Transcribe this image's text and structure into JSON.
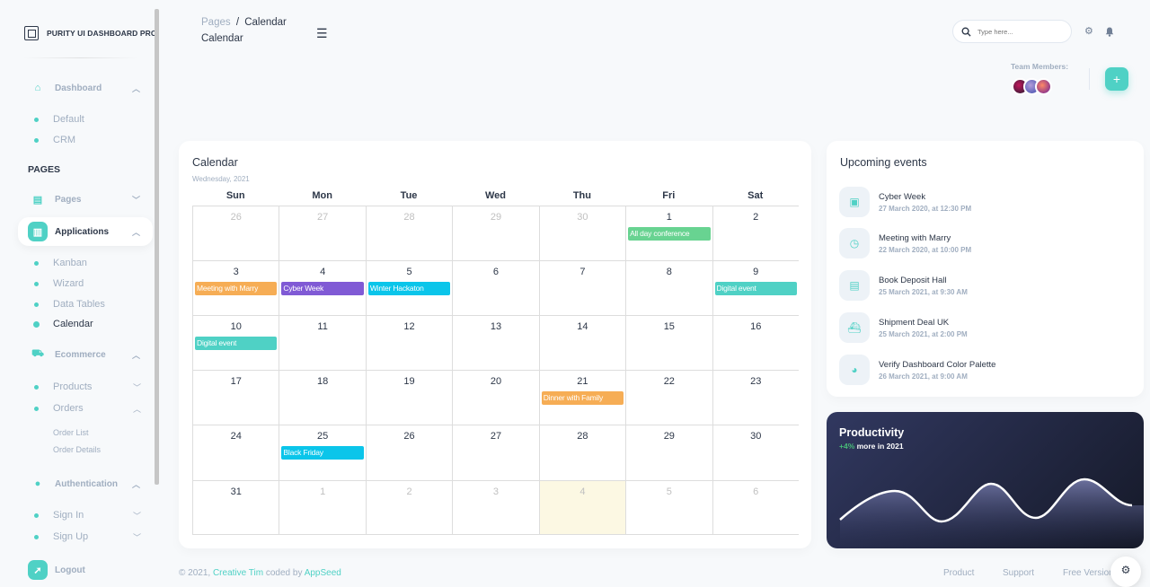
{
  "brand": {
    "name": "PURITY UI DASHBOARD PRO"
  },
  "sidebar": {
    "dashboard": "Dashboard",
    "dashboard_sub": [
      "Default",
      "CRM"
    ],
    "pages_header": "PAGES",
    "pages": "Pages",
    "applications": "Applications",
    "applications_sub": [
      "Kanban",
      "Wizard",
      "Data Tables",
      "Calendar"
    ],
    "ecommerce": "Ecommerce",
    "products": "Products",
    "orders": "Orders",
    "orders_sub": [
      "Order List",
      "Order Details"
    ],
    "authentication": "Authentication",
    "signin": "Sign In",
    "signup": "Sign Up",
    "logout": "Logout"
  },
  "topbar": {
    "breadcrumb_root": "Pages",
    "breadcrumb_sep": "/",
    "breadcrumb_current": "Calendar",
    "title": "Calendar",
    "search_placeholder": "Type here...",
    "team_label": "Team Members:",
    "add_label": "+"
  },
  "calendar": {
    "title": "Calendar",
    "subtitle": "Wednesday, 2021",
    "weekdays": [
      "Sun",
      "Mon",
      "Tue",
      "Wed",
      "Thu",
      "Fri",
      "Sat"
    ],
    "weeks": [
      [
        {
          "d": "26",
          "m": true
        },
        {
          "d": "27",
          "m": true
        },
        {
          "d": "28",
          "m": true
        },
        {
          "d": "29",
          "m": true
        },
        {
          "d": "30",
          "m": true
        },
        {
          "d": "1",
          "e": {
            "t": "All day conference",
            "c": "#68d391"
          }
        },
        {
          "d": "2"
        }
      ],
      [
        {
          "d": "3",
          "e": {
            "t": "Meeting with Marry",
            "c": "#f6ad55"
          }
        },
        {
          "d": "4",
          "e": {
            "t": "Cyber Week",
            "c": "#805ad5"
          }
        },
        {
          "d": "5",
          "e": {
            "t": "Winter Hackaton",
            "c": "#0bc5ea"
          }
        },
        {
          "d": "6"
        },
        {
          "d": "7"
        },
        {
          "d": "8"
        },
        {
          "d": "9",
          "e": {
            "t": "Digital event",
            "c": "#4fd1c5"
          }
        }
      ],
      [
        {
          "d": "10",
          "e": {
            "t": "Digital event",
            "c": "#4fd1c5"
          }
        },
        {
          "d": "11"
        },
        {
          "d": "12"
        },
        {
          "d": "13"
        },
        {
          "d": "14"
        },
        {
          "d": "15"
        },
        {
          "d": "16"
        }
      ],
      [
        {
          "d": "17"
        },
        {
          "d": "18"
        },
        {
          "d": "19"
        },
        {
          "d": "20"
        },
        {
          "d": "21",
          "e": {
            "t": "Dinner with Family",
            "c": "#f6ad55"
          }
        },
        {
          "d": "22"
        },
        {
          "d": "23"
        }
      ],
      [
        {
          "d": "24"
        },
        {
          "d": "25",
          "e": {
            "t": "Black Friday",
            "c": "#0bc5ea"
          }
        },
        {
          "d": "26"
        },
        {
          "d": "27"
        },
        {
          "d": "28"
        },
        {
          "d": "29"
        },
        {
          "d": "30"
        }
      ],
      [
        {
          "d": "31"
        },
        {
          "d": "1",
          "m": true
        },
        {
          "d": "2",
          "m": true
        },
        {
          "d": "3",
          "m": true
        },
        {
          "d": "4",
          "m": true,
          "today": true
        },
        {
          "d": "5",
          "m": true
        },
        {
          "d": "6",
          "m": true
        }
      ]
    ]
  },
  "upcoming": {
    "title": "Upcoming events",
    "items": [
      {
        "name": "Cyber Week",
        "time": "27 March 2020, at 12:30 PM",
        "icon": "wallet-icon"
      },
      {
        "name": "Meeting with Marry",
        "time": "22 March 2020, at 10:00 PM",
        "icon": "clock-icon"
      },
      {
        "name": "Book Deposit Hall",
        "time": "25 March 2021, at 9:30 AM",
        "icon": "document-icon"
      },
      {
        "name": "Shipment Deal UK",
        "time": "25 March 2021, at 2:00 PM",
        "icon": "ship-icon"
      },
      {
        "name": "Verify Dashboard Color Palette",
        "time": "26 March 2021, at 9:00 AM",
        "icon": "palette-icon"
      }
    ]
  },
  "productivity": {
    "title": "Productivity",
    "pct": "+4%",
    "rest": "more in 2021"
  },
  "footer": {
    "prefix": "© 2021,",
    "author": "Creative Tim",
    "mid": "coded by",
    "coder": "AppSeed",
    "links": [
      "Product",
      "Support",
      "Free Version"
    ]
  }
}
